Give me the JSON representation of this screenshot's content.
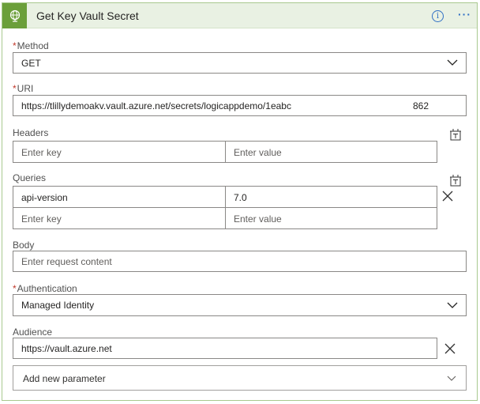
{
  "header": {
    "title": "Get Key Vault Secret",
    "icon": "globe-icon",
    "accent": "#6b9f3a"
  },
  "method": {
    "label": "Method",
    "required_mark": "*",
    "value": "GET"
  },
  "uri": {
    "label": "URI",
    "required_mark": "*",
    "value": "https://tlillydemoakv.vault.azure.net/secrets/logicappdemo/1eabc",
    "value_tail": "862"
  },
  "headers": {
    "label": "Headers",
    "key_placeholder": "Enter key",
    "value_placeholder": "Enter value"
  },
  "queries": {
    "label": "Queries",
    "rows": [
      {
        "key": "api-version",
        "value": "7.0"
      }
    ],
    "key_placeholder": "Enter key",
    "value_placeholder": "Enter value"
  },
  "body": {
    "label": "Body",
    "placeholder": "Enter request content"
  },
  "authentication": {
    "label": "Authentication",
    "required_mark": "*",
    "value": "Managed Identity"
  },
  "audience": {
    "label": "Audience",
    "value": "https://vault.azure.net"
  },
  "add_param": {
    "label": "Add new parameter"
  }
}
